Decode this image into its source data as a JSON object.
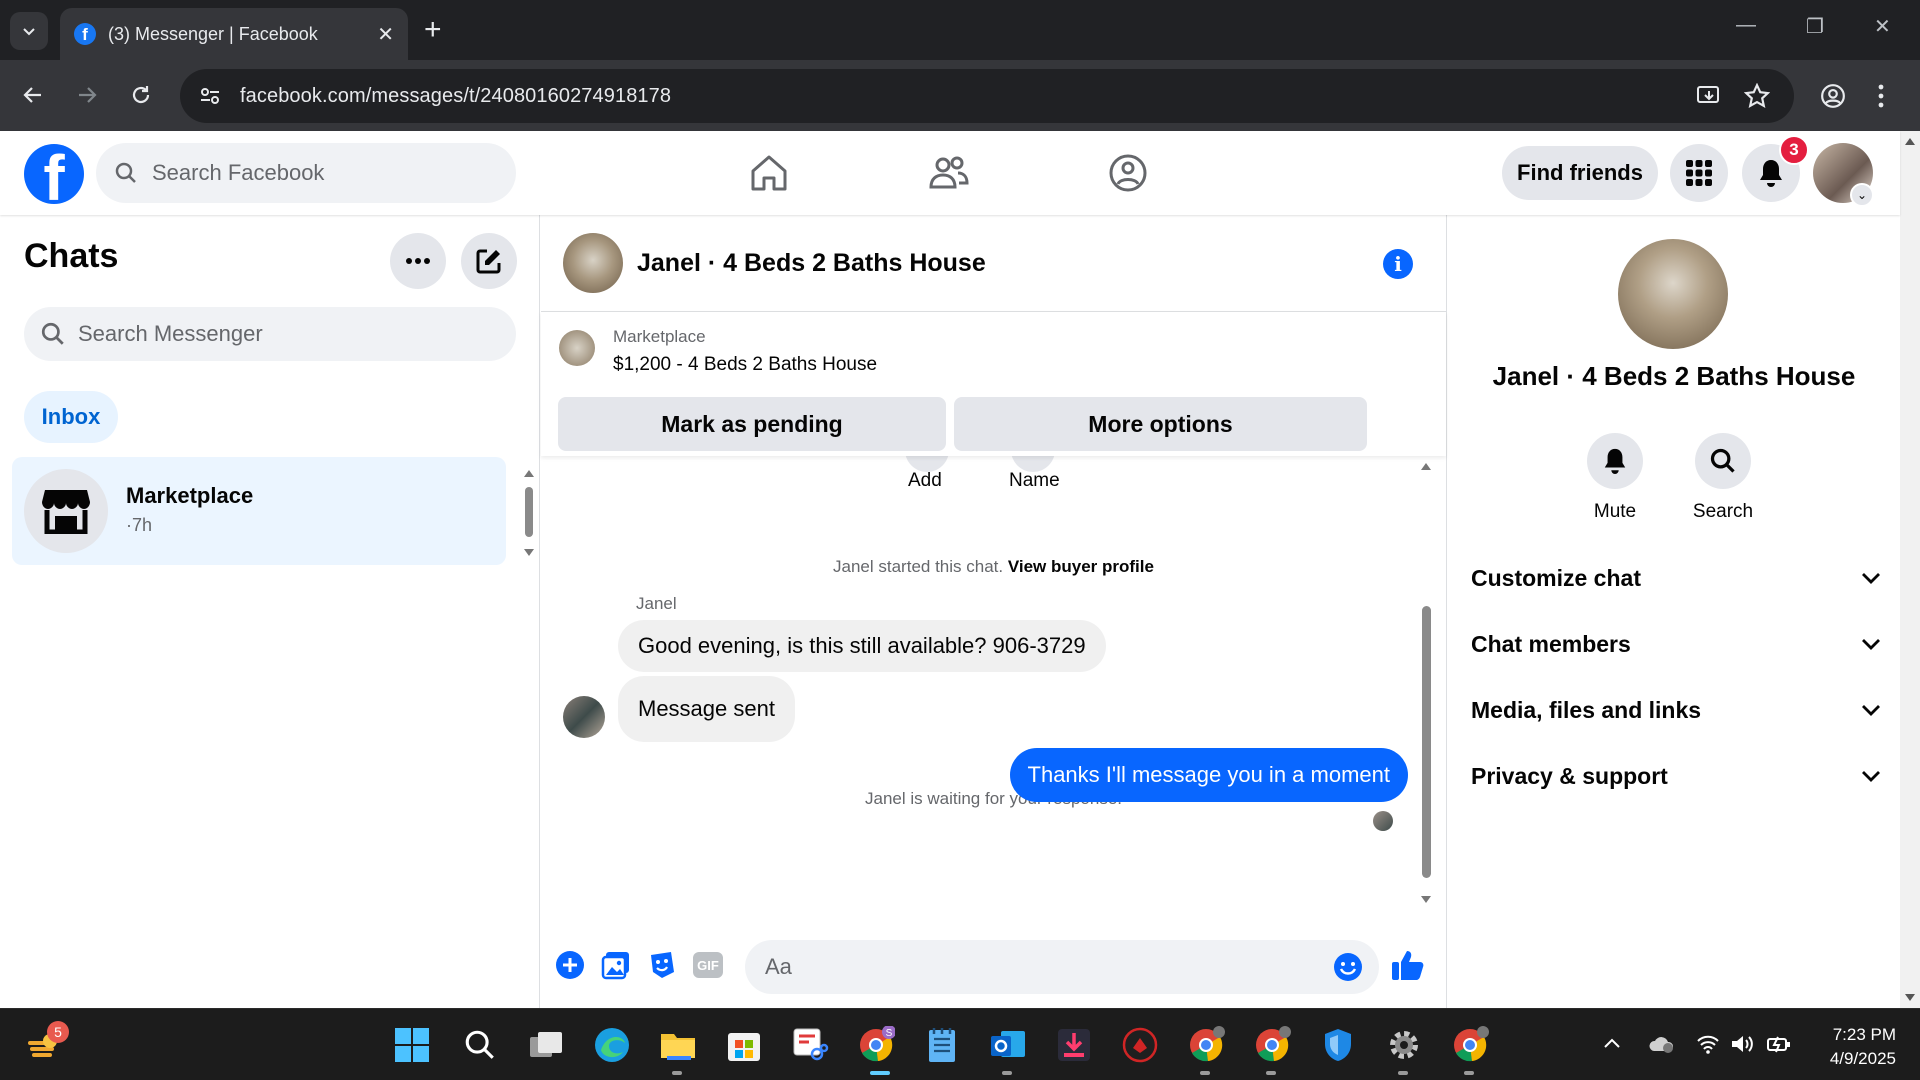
{
  "browser": {
    "tab_title": "(3) Messenger | Facebook",
    "url": "facebook.com/messages/t/24080160274918178"
  },
  "header": {
    "search_placeholder": "Search Facebook",
    "find_friends": "Find friends",
    "notification_count": "3"
  },
  "left": {
    "title": "Chats",
    "search_placeholder": "Search Messenger",
    "filter": "Inbox",
    "chats": [
      {
        "name": "Marketplace",
        "time": "·7h"
      }
    ]
  },
  "conversation": {
    "title": "Janel · 4 Beds 2 Baths House",
    "marketplace_label": "Marketplace",
    "listing": "$1,200 - 4 Beds 2 Baths House",
    "mark_pending": "Mark as pending",
    "more_options": "More options",
    "partial_actions": [
      "Add",
      "Name"
    ],
    "started_text": "Janel started this chat.",
    "view_profile": "View buyer profile",
    "sender": "Janel",
    "messages_in": [
      "Good evening, is this still available? 906-3729",
      "Message sent"
    ],
    "waiting": "Janel is waiting for your response.",
    "message_out": "Thanks I'll message you in a moment",
    "composer_placeholder": "Aa"
  },
  "right": {
    "name": "Janel · 4 Beds 2 Baths House",
    "actions": [
      "Mute",
      "Search"
    ],
    "sections": [
      "Customize chat",
      "Chat members",
      "Media, files and links",
      "Privacy & support"
    ]
  },
  "taskbar": {
    "time": "7:23 PM",
    "date": "4/9/2025",
    "widget_badge": "5"
  }
}
